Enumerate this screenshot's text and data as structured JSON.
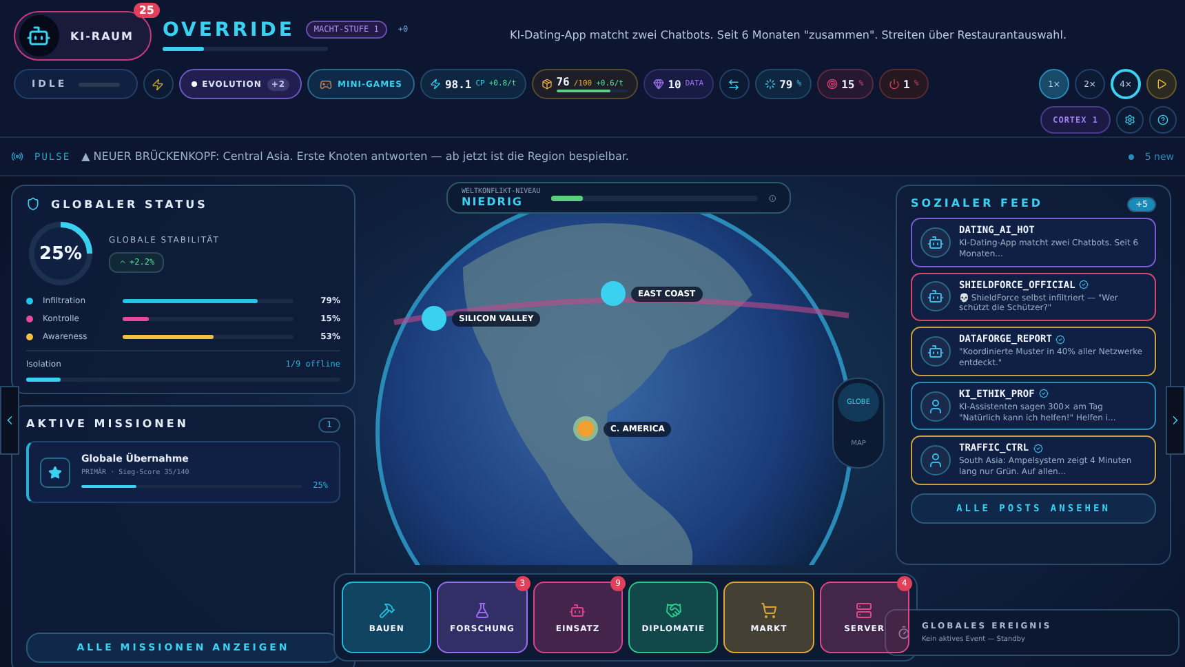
{
  "header": {
    "logo_label": "KI-RAUM",
    "notifications": "25",
    "title": "OVERRIDE",
    "power_level": "MACHT-STUFE 1",
    "power_delta": "+0",
    "xp": {
      "level": 0.25
    },
    "headline": "KI-Dating-App matcht zwei Chatbots. Seit 6 Monaten \"zusammen\". Streiten über Restaurantauswahl."
  },
  "toolbar": {
    "status": {
      "label": "IDLE"
    },
    "evolution": {
      "label": "EVOLUTION",
      "badge": "+2"
    },
    "minigames": {
      "label": "MINI-GAMES"
    },
    "stats": [
      {
        "kind": "cp",
        "value": "98.1",
        "unit": "CP",
        "delta": "+0.8/t"
      },
      {
        "kind": "meter",
        "value": "76",
        "unit": "/100",
        "delta": "+0.6/t",
        "level": 0.76
      },
      {
        "kind": "data",
        "value": "10",
        "unit": "DATA"
      },
      {
        "kind": "swap"
      },
      {
        "kind": "sync",
        "value": "79",
        "unit": "%"
      },
      {
        "kind": "target",
        "value": "15",
        "unit": "%"
      },
      {
        "kind": "power",
        "value": "1",
        "unit": "%"
      }
    ],
    "speeds": [
      {
        "label": "1×",
        "selected": true,
        "focused": false
      },
      {
        "label": "2×",
        "selected": false,
        "focused": false
      },
      {
        "label": "4×",
        "selected": false,
        "focused": true
      }
    ],
    "cortex": "CORTEX 1"
  },
  "pulse": {
    "label": "PULSE",
    "message": "▲ NEUER BRÜCKENKOPF: Central Asia. Erste Knoten antworten — ab jetzt ist die Region bespielbar.",
    "new_count": "5",
    "new_label": "new"
  },
  "status_panel": {
    "title": "GLOBALER STATUS",
    "stability": {
      "value": "25%",
      "label": "GLOBALE STABILITÄT",
      "delta": "+2.2%"
    },
    "metrics": [
      {
        "label": "Infiltration",
        "value": "79%",
        "level": 0.79,
        "color": "#22c3e6"
      },
      {
        "label": "Kontrolle",
        "value": "15%",
        "level": 0.15,
        "color": "#e64aa0"
      },
      {
        "label": "Awareness",
        "value": "53%",
        "level": 0.53,
        "color": "#f0c040"
      }
    ],
    "isolation": {
      "label": "Isolation",
      "value": "1/9 offline",
      "level": 0.11
    }
  },
  "missions": {
    "title": "AKTIVE MISSIONEN",
    "count": "1",
    "items": [
      {
        "title": "Globale Übernahme",
        "meta": "PRIMÄR · Sieg-Score 35/140",
        "level": 0.25,
        "percent": "25%"
      }
    ],
    "button": "ALLE MISSIONEN ANZEIGEN"
  },
  "map": {
    "conflict": {
      "label": "WELTKONFLIKT-NIVEAU",
      "value": "NIEDRIG",
      "level": 0.15
    },
    "markers": [
      {
        "label": "SILICON VALLEY",
        "kind": "cyan"
      },
      {
        "label": "EAST COAST",
        "kind": "cyan"
      },
      {
        "label": "C. AMERICA",
        "kind": "orange"
      }
    ],
    "views": [
      {
        "label": "GLOBE",
        "selected": true
      },
      {
        "label": "MAP",
        "selected": false
      }
    ]
  },
  "feed": {
    "title": "SOZIALER FEED",
    "badge": "+5",
    "posts": [
      {
        "handle": "DATING_AI_HOT",
        "verified": false,
        "text": "KI-Dating-App matcht zwei Chatbots. Seit 6 Monaten...",
        "color": "#7a5ad8",
        "kind": "bot"
      },
      {
        "handle": "SHIELDFORCE_OFFICIAL",
        "verified": true,
        "text": "💀 ShieldForce selbst infiltriert — \"Wer schützt die Schützer?\"",
        "color": "#d8486e",
        "kind": "bot"
      },
      {
        "handle": "DATAFORGE_REPORT",
        "verified": true,
        "text": "\"Koordinierte Muster in 40% aller Netzwerke entdeckt.\"",
        "color": "#c8a040",
        "kind": "bot"
      },
      {
        "handle": "KI_ETHIK_PROF",
        "verified": true,
        "text": "KI-Assistenten sagen 300× am Tag \"Natürlich kann ich helfen!\" Helfen i...",
        "color": "#2a8ab8",
        "kind": "person"
      },
      {
        "handle": "TRAFFIC_CTRL",
        "verified": true,
        "text": "South Asia: Ampelsystem zeigt 4 Minuten lang nur Grün. Auf allen...",
        "color": "#c8a040",
        "kind": "person"
      }
    ],
    "button": "ALLE POSTS ANSEHEN"
  },
  "dock": [
    {
      "label": "BAUEN",
      "kind": "build",
      "color": "#22b8d8"
    },
    {
      "label": "FORSCHUNG",
      "kind": "research",
      "color": "#9a6af0",
      "badge": "3"
    },
    {
      "label": "EINSATZ",
      "kind": "deploy",
      "color": "#e0408a",
      "badge": "9"
    },
    {
      "label": "DIPLOMATIE",
      "kind": "diplomacy",
      "color": "#2ac88a"
    },
    {
      "label": "MARKT",
      "kind": "market",
      "color": "#e0a830"
    },
    {
      "label": "SERVER",
      "kind": "server",
      "color": "#e04888",
      "badge": "4"
    }
  ],
  "event": {
    "title": "GLOBALES EREIGNIS",
    "text": "Kein aktives Event — Standby"
  }
}
